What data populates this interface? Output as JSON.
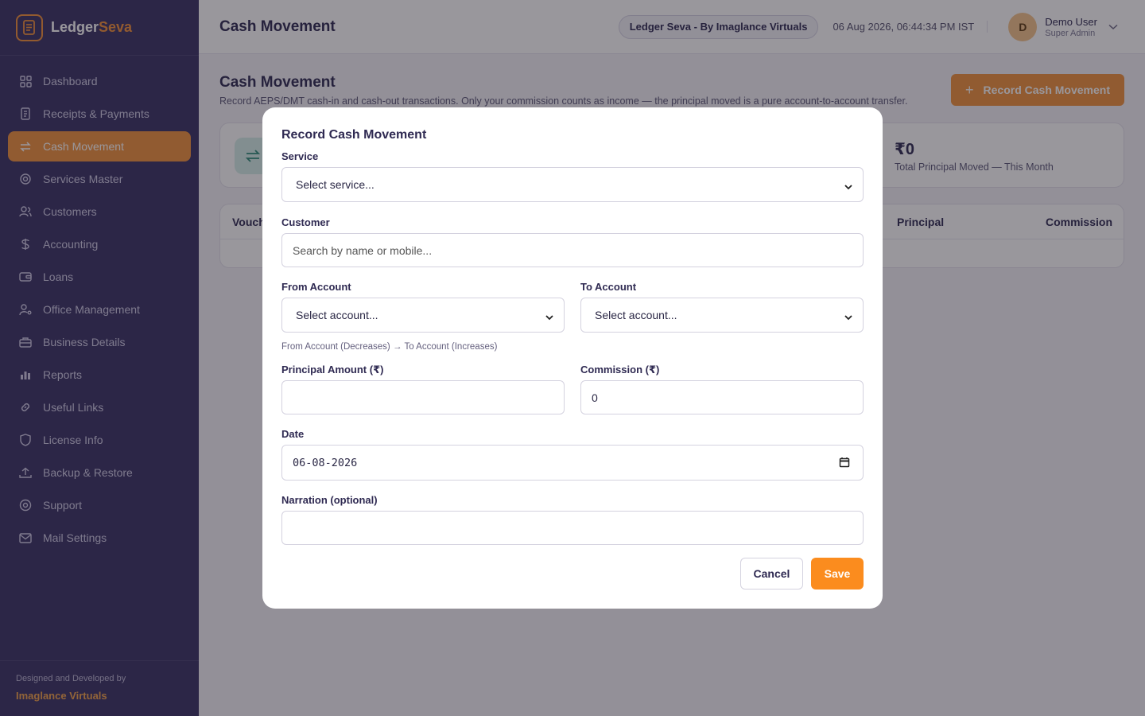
{
  "brand": {
    "name_primary": "Ledger",
    "name_accent": "Seva"
  },
  "sidebar": {
    "items": [
      {
        "label": "Dashboard",
        "icon": "dashboard-icon"
      },
      {
        "label": "Receipts & Payments",
        "icon": "receipt-icon"
      },
      {
        "label": "Cash Movement",
        "icon": "transfer-icon",
        "active": true
      },
      {
        "label": "Services Master",
        "icon": "gear-icon"
      },
      {
        "label": "Customers",
        "icon": "users-icon"
      },
      {
        "label": "Accounting",
        "icon": "dollar-icon"
      },
      {
        "label": "Loans",
        "icon": "wallet-icon"
      },
      {
        "label": "Office Management",
        "icon": "user-cog-icon"
      },
      {
        "label": "Business Details",
        "icon": "briefcase-icon"
      },
      {
        "label": "Reports",
        "icon": "bar-chart-icon"
      },
      {
        "label": "Useful Links",
        "icon": "link-icon"
      },
      {
        "label": "License Info",
        "icon": "shield-icon"
      },
      {
        "label": "Backup & Restore",
        "icon": "upload-icon"
      },
      {
        "label": "Support",
        "icon": "support-icon"
      },
      {
        "label": "Mail Settings",
        "icon": "mail-icon"
      }
    ],
    "footer_note": "Designed and Developed by",
    "footer_company": "Imaglance Virtuals"
  },
  "header": {
    "title": "Cash Movement",
    "org_pill": "Ledger Seva - By Imaglance Virtuals",
    "datetime": "06 Aug 2026, 06:44:34 PM IST",
    "user": {
      "initial": "D",
      "name": "Demo User",
      "role": "Super Admin"
    }
  },
  "page": {
    "title": "Cash Movement",
    "subtitle": "Record AEPS/DMT cash-in and cash-out transactions. Only your commission counts as income — the principal moved is a pure account-to-account transfer.",
    "primary_button": "Record Cash Movement",
    "stat": {
      "value": "₹0",
      "label": "Total Principal Moved — This Month"
    },
    "table_headers": {
      "voucher": "Vouch",
      "principal": "Principal",
      "commission": "Commission"
    }
  },
  "modal": {
    "title": "Record Cash Movement",
    "service": {
      "label": "Service",
      "value": "Select service..."
    },
    "customer": {
      "label": "Customer",
      "placeholder": "Search by name or mobile..."
    },
    "from_account": {
      "label": "From Account",
      "value": "Select account..."
    },
    "to_account": {
      "label": "To Account",
      "value": "Select account..."
    },
    "account_hint": "From Account (Decreases) → To Account (Increases)",
    "principal": {
      "label": "Principal Amount (₹)",
      "value": ""
    },
    "commission": {
      "label": "Commission (₹)",
      "value": "0"
    },
    "date": {
      "label": "Date",
      "value": "06-08-2026"
    },
    "narration": {
      "label": "Narration (optional)",
      "value": ""
    },
    "cancel_label": "Cancel",
    "save_label": "Save"
  },
  "colors": {
    "sidebar_bg": "#3a3264",
    "accent": "#f0923c",
    "save": "#fb8c1e"
  }
}
